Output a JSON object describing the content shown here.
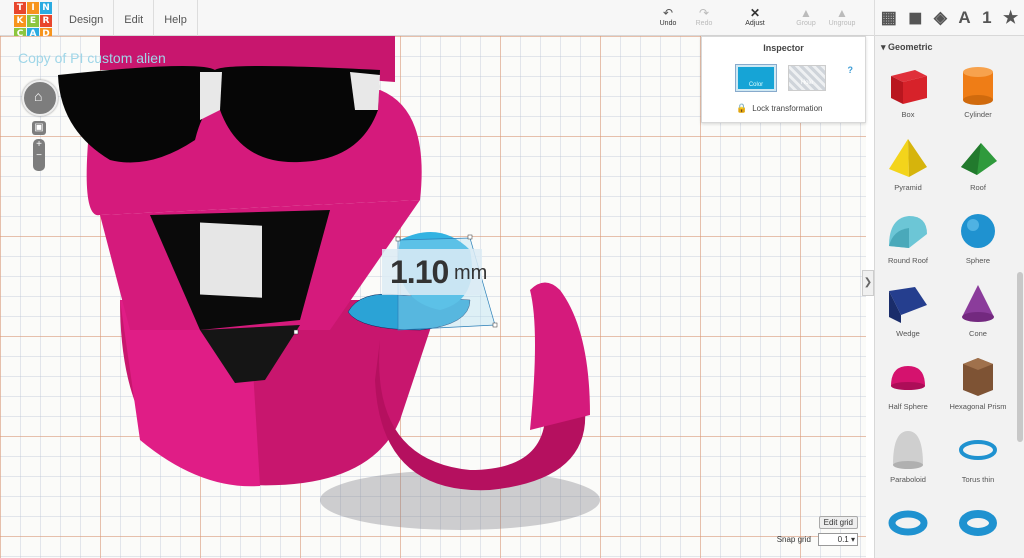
{
  "app": {
    "logo_letters": [
      "T",
      "I",
      "N",
      "K",
      "E",
      "R",
      "C",
      "A",
      "D"
    ],
    "logo_colors": [
      "#e8462d",
      "#f7941d",
      "#2aabe1",
      "#f7941d",
      "#8cc63f",
      "#e8462d",
      "#8cc63f",
      "#2aabe1",
      "#f7941d"
    ]
  },
  "menu": {
    "items": [
      "Design",
      "Edit",
      "Help"
    ]
  },
  "toolbar": {
    "undo": "Undo",
    "redo": "Redo",
    "adjust": "Adjust",
    "group": "Group",
    "ungroup": "Ungroup"
  },
  "view_icons": [
    "grid-view-icon",
    "box-view-icon",
    "components-icon",
    "text-A-icon",
    "number-1-icon",
    "star-icon"
  ],
  "view_icon_glyphs": [
    "▦",
    "◼",
    "◈",
    "A",
    "1",
    "★"
  ],
  "canvas": {
    "design_title": "Copy of PI custom alien",
    "dimension_value": "1.10",
    "dimension_unit": "mm",
    "edit_grid": "Edit grid",
    "snap_label": "Snap grid",
    "snap_value": "0.1"
  },
  "inspector": {
    "title": "Inspector",
    "color_label": "Color",
    "hole_label": "Hole",
    "help": "?",
    "lock_label": "Lock transformation"
  },
  "panel": {
    "section": "Geometric",
    "shapes": [
      {
        "label": "Box",
        "color": "#d7222a"
      },
      {
        "label": "Cylinder",
        "color": "#ef7d16"
      },
      {
        "label": "Pyramid",
        "color": "#f3d41b"
      },
      {
        "label": "Roof",
        "color": "#2f9a3c"
      },
      {
        "label": "Round Roof",
        "color": "#6cc6d6"
      },
      {
        "label": "Sphere",
        "color": "#1f92d0"
      },
      {
        "label": "Wedge",
        "color": "#253e8e"
      },
      {
        "label": "Cone",
        "color": "#8b3c9b"
      },
      {
        "label": "Half Sphere",
        "color": "#d5126e"
      },
      {
        "label": "Hexagonal Prism",
        "color": "#7e5334"
      },
      {
        "label": "Paraboloid",
        "color": "#cfcfcf"
      },
      {
        "label": "Torus thin",
        "color": "#1f92d0"
      },
      {
        "label": "",
        "color": "#1f92d0"
      },
      {
        "label": "",
        "color": "#1f92d0"
      }
    ]
  }
}
